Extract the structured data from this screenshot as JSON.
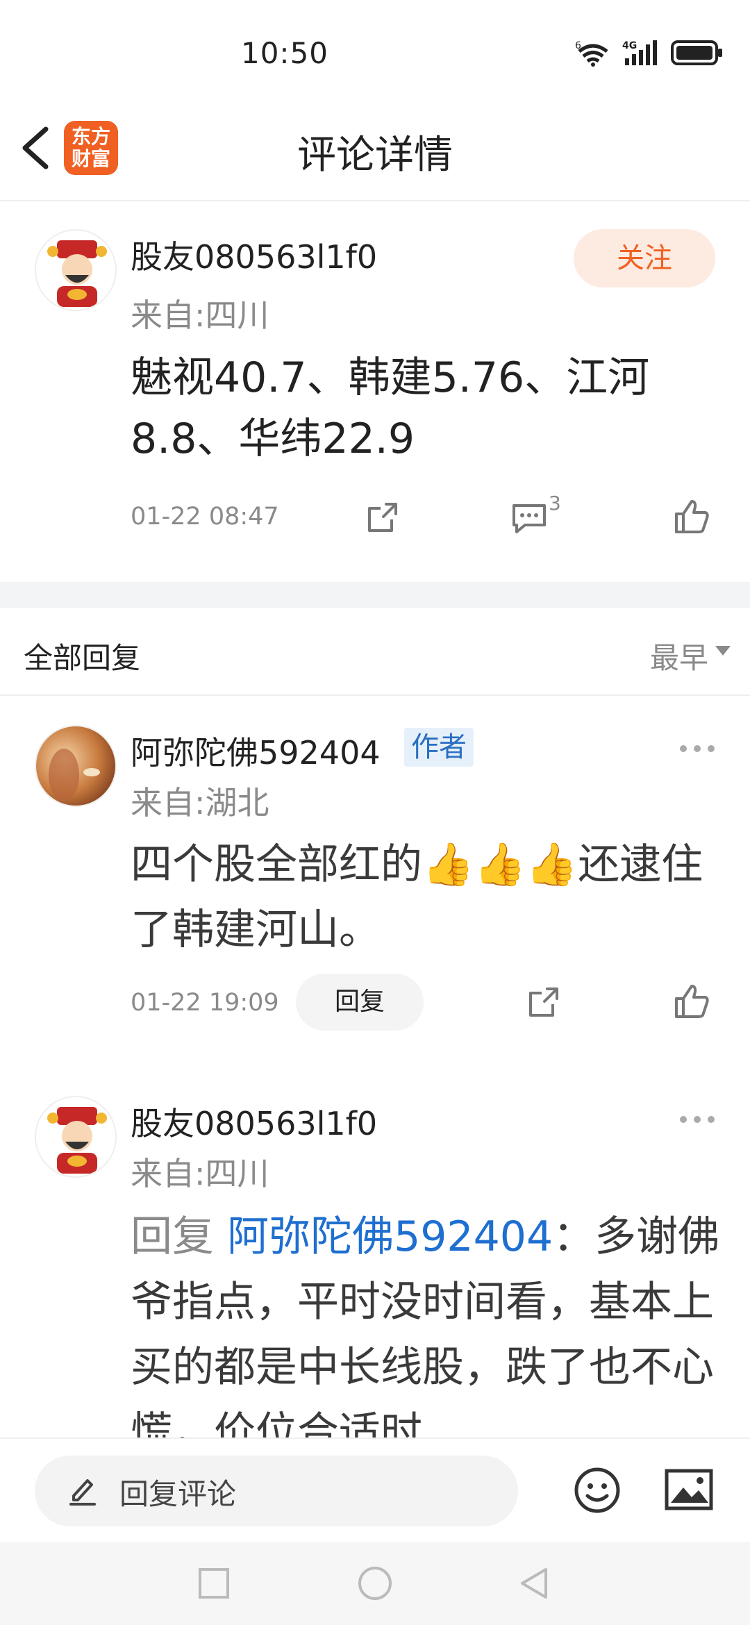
{
  "status_bar": {
    "time": "10:50",
    "signal_labels": [
      "6",
      "4G"
    ],
    "battery_icon": "battery-full-icon"
  },
  "header": {
    "title": "评论详情",
    "logo_line1": "东方",
    "logo_line2": "财富",
    "back_icon": "chevron-left-icon"
  },
  "post": {
    "username": "股友080563l1f0",
    "location": "来自:四川",
    "follow_label": "关注",
    "body": "魅视40.7、韩建5.76、江河8.8、华纬22.9",
    "time": "01-22 08:47",
    "comment_count": "3",
    "icons": [
      "share-icon",
      "comment-icon",
      "like-icon"
    ]
  },
  "replies_section": {
    "title": "全部回复",
    "sort_label": "最早"
  },
  "replies": [
    {
      "username": "阿弥陀佛592404",
      "badge": "作者",
      "location": "来自:湖北",
      "text": "四个股全部红的👍👍👍还逮住了韩建河山。",
      "time": "01-22 19:09",
      "reply_label": "回复"
    },
    {
      "username": "股友080563l1f0",
      "location": "来自:四川",
      "reply_prefix": "回复 ",
      "mention": "阿弥陀佛592404",
      "text": "：多谢佛爷指点，平时没时间看，基本上买的都是中长线股，跌了也不心慌，价位合适时"
    }
  ],
  "composer": {
    "placeholder": "回复评论",
    "icons": [
      "pencil-icon",
      "emoji-icon",
      "image-icon"
    ]
  },
  "nav": {
    "icons": [
      "recent-apps-icon",
      "home-icon",
      "back-icon"
    ]
  }
}
